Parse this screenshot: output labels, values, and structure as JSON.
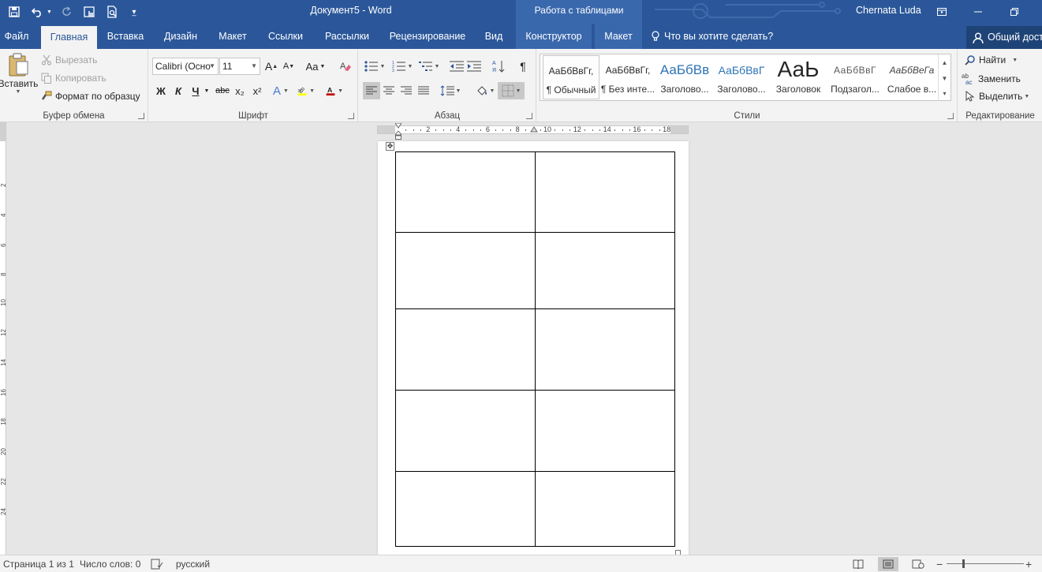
{
  "titlebar": {
    "doc_title": "Документ5 - Word",
    "context_tab_group": "Работа с таблицами",
    "user_name": "Chernata Luda"
  },
  "tabs": [
    {
      "label": "Файл"
    },
    {
      "label": "Главная"
    },
    {
      "label": "Вставка"
    },
    {
      "label": "Дизайн"
    },
    {
      "label": "Макет"
    },
    {
      "label": "Ссылки"
    },
    {
      "label": "Рассылки"
    },
    {
      "label": "Рецензирование"
    },
    {
      "label": "Вид"
    },
    {
      "label": "Конструктор"
    },
    {
      "label": "Макет"
    }
  ],
  "tell_me": {
    "placeholder": "Что вы хотите сделать?"
  },
  "share": {
    "label": "Общий досту"
  },
  "clipboard": {
    "paste_label": "Вставить",
    "cut_label": "Вырезать",
    "copy_label": "Копировать",
    "format_painter_label": "Формат по образцу",
    "group_label": "Буфер обмена"
  },
  "font": {
    "font_name": "Calibri (Осно",
    "font_size": "11",
    "bold": "Ж",
    "italic": "К",
    "underline": "Ч",
    "strikethrough": "abc",
    "subscript": "x₂",
    "superscript": "x²",
    "grow": "A",
    "shrink": "A",
    "change_case": "Aa",
    "font_color": "A",
    "group_label": "Шрифт"
  },
  "paragraph": {
    "group_label": "Абзац"
  },
  "styles": {
    "items": [
      {
        "preview": "АаБбВвГг,",
        "name": "¶ Обычный"
      },
      {
        "preview": "АаБбВвГг,",
        "name": "¶ Без инте..."
      },
      {
        "preview": "АаБбВв",
        "name": "Заголово..."
      },
      {
        "preview": "АаБбВвГ",
        "name": "Заголово..."
      },
      {
        "preview": "АаЬ",
        "name": "Заголовок"
      },
      {
        "preview": "АаБбВвГ",
        "name": "Подзагол..."
      },
      {
        "preview": "АаБбВеГа",
        "name": "Слабое в..."
      }
    ],
    "group_label": "Стили"
  },
  "editing": {
    "find_label": "Найти",
    "replace_label": "Заменить",
    "select_label": "Выделить",
    "group_label": "Редактирование"
  },
  "ruler": {
    "h_ticks": [
      "2",
      "4",
      "6",
      "8",
      "10",
      "12",
      "14",
      "16",
      "18"
    ],
    "v_ticks": [
      "2",
      "4",
      "6",
      "8",
      "10",
      "12",
      "14",
      "16",
      "18",
      "20",
      "22",
      "24"
    ]
  },
  "table": {
    "rows": 5,
    "cols": 2
  },
  "statusbar": {
    "page": "Страница 1 из 1",
    "words": "Число слов: 0",
    "language": "русский"
  },
  "colors": {
    "title_bar": "#2b579a",
    "ribbon": "#f3f3f3",
    "workspace": "#e6e6e6",
    "highlight_yellow": "#ffff00",
    "font_red": "#c00000"
  }
}
